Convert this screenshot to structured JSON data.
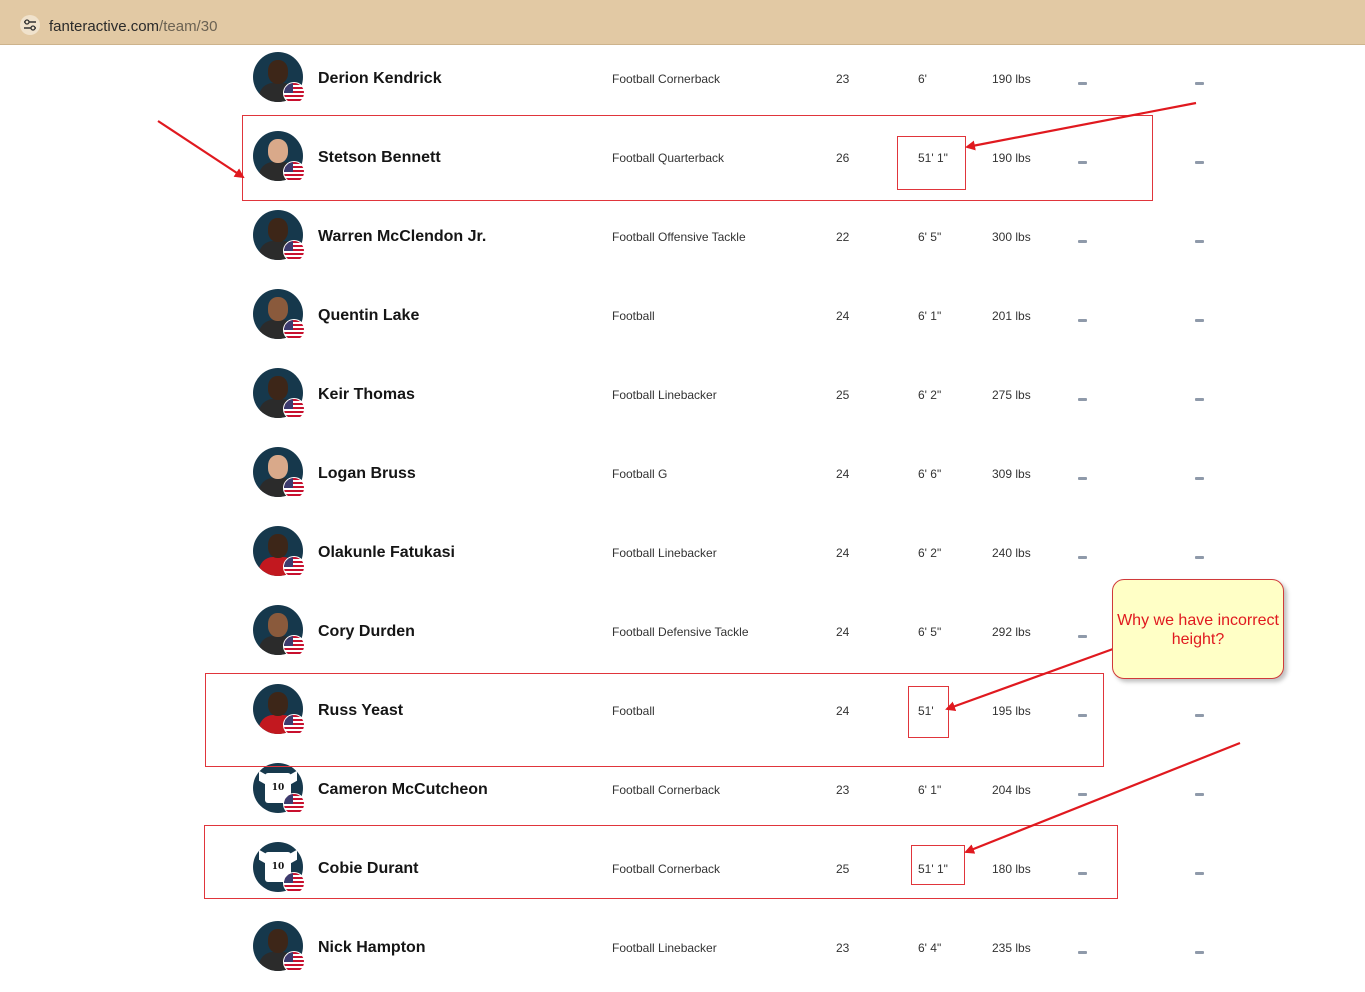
{
  "browser": {
    "url_host": "fanteractive.com",
    "url_path": "/team/30",
    "site_info_icon": "tune-icon"
  },
  "players": [
    {
      "name": "Derion Kendrick",
      "position": "Football Cornerback",
      "age": "23",
      "height": "6'",
      "weight": "190 lbs",
      "col1": "–",
      "col2": "–",
      "photo": "player-photo"
    },
    {
      "name": "Stetson Bennett",
      "position": "Football Quarterback",
      "age": "26",
      "height": "51' 1\"",
      "weight": "190 lbs",
      "col1": "–",
      "col2": "–",
      "photo": "player-photo"
    },
    {
      "name": "Warren McClendon Jr.",
      "position": "Football Offensive Tackle",
      "age": "22",
      "height": "6' 5\"",
      "weight": "300 lbs",
      "col1": "–",
      "col2": "–",
      "photo": "player-photo"
    },
    {
      "name": "Quentin Lake",
      "position": "Football",
      "age": "24",
      "height": "6' 1\"",
      "weight": "201 lbs",
      "col1": "–",
      "col2": "–",
      "photo": "player-photo"
    },
    {
      "name": "Keir Thomas",
      "position": "Football Linebacker",
      "age": "25",
      "height": "6' 2\"",
      "weight": "275 lbs",
      "col1": "–",
      "col2": "–",
      "photo": "player-photo"
    },
    {
      "name": "Logan Bruss",
      "position": "Football G",
      "age": "24",
      "height": "6' 6\"",
      "weight": "309 lbs",
      "col1": "–",
      "col2": "–",
      "photo": "player-photo"
    },
    {
      "name": "Olakunle Fatukasi",
      "position": "Football Linebacker",
      "age": "24",
      "height": "6' 2\"",
      "weight": "240 lbs",
      "col1": "–",
      "col2": "–",
      "photo": "player-photo"
    },
    {
      "name": "Cory Durden",
      "position": "Football Defensive Tackle",
      "age": "24",
      "height": "6' 5\"",
      "weight": "292 lbs",
      "col1": "–",
      "col2": "–",
      "photo": "player-photo"
    },
    {
      "name": "Russ Yeast",
      "position": "Football",
      "age": "24",
      "height": "51'",
      "weight": "195 lbs",
      "col1": "–",
      "col2": "–",
      "photo": "player-photo"
    },
    {
      "name": "Cameron McCutcheon",
      "position": "Football Cornerback",
      "age": "23",
      "height": "6' 1\"",
      "weight": "204 lbs",
      "col1": "–",
      "col2": "–",
      "photo": "jersey-placeholder",
      "jersey_number": "10"
    },
    {
      "name": "Cobie Durant",
      "position": "Football Cornerback",
      "age": "25",
      "height": "51' 1\"",
      "weight": "180 lbs",
      "col1": "–",
      "col2": "–",
      "photo": "jersey-placeholder",
      "jersey_number": "10"
    },
    {
      "name": "Nick Hampton",
      "position": "Football Linebacker",
      "age": "23",
      "height": "6' 4\"",
      "weight": "235 lbs",
      "col1": "–",
      "col2": "–",
      "photo": "player-photo"
    }
  ],
  "annotation": {
    "callout_text": "Why we have incorrect height?",
    "highlight_color": "#e0353b",
    "callout_bg": "#ffffc6"
  }
}
